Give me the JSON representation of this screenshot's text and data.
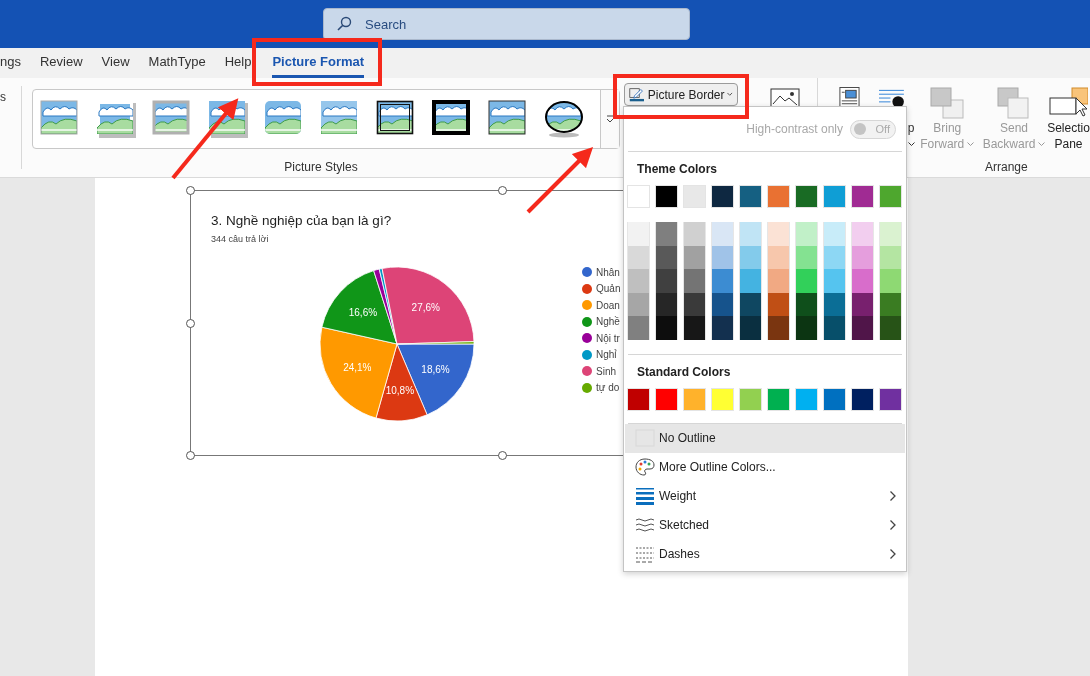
{
  "title_bar": {
    "search": {
      "placeholder": "Search"
    }
  },
  "tabs": [
    {
      "label": "ngs",
      "selected": false
    },
    {
      "label": "Review",
      "selected": false
    },
    {
      "label": "View",
      "selected": false
    },
    {
      "label": "MathType",
      "selected": false
    },
    {
      "label": "Help",
      "selected": false
    },
    {
      "label": "Picture Format",
      "selected": true
    }
  ],
  "ribbon": {
    "left_fragment": "s",
    "picture_styles": {
      "label": "Picture Styles"
    },
    "picture_border": {
      "label": "Picture Border",
      "dropdown": true
    },
    "wrap_fragment": {
      "label": "p",
      "dropdown": true
    },
    "arrange": {
      "label": "Arrange",
      "buttons": [
        {
          "kind": "bring-forward",
          "lines": [
            "Bring",
            "Forward"
          ],
          "disabled": true,
          "dropdown": true
        },
        {
          "kind": "send-backward",
          "lines": [
            "Send",
            "Backward"
          ],
          "disabled": true,
          "dropdown": true
        },
        {
          "kind": "selection-pane",
          "lines": [
            "Selectio",
            "Pane"
          ],
          "disabled": false,
          "dropdown": false
        }
      ]
    }
  },
  "document": {
    "picture": {
      "subtitle": "344 câu trả lời",
      "chart_data": {
        "type": "pie",
        "title": "3. Nghề nghiệp của bạn là gì?",
        "categories": [
          "Nhân",
          "Quản",
          "Doan",
          "Nghề",
          "Nội tr",
          "Nghỉ",
          "Sinh",
          "tự do"
        ],
        "values": [
          18.6,
          10.8,
          24.1,
          16.6,
          1.2,
          0.6,
          27.6,
          0.5
        ],
        "value_labels": [
          "18,6%",
          "10,8%",
          "24,1%",
          "16,6%",
          null,
          null,
          "27,6%",
          null
        ],
        "colors": [
          "#3366cc",
          "#dc3912",
          "#ff9900",
          "#109618",
          "#990099",
          "#0099c6",
          "#dd4477",
          "#66aa00"
        ]
      }
    }
  },
  "border_menu": {
    "high_contrast": {
      "label": "High-contrast only",
      "on": false,
      "disabled": true,
      "state_label": "Off"
    },
    "theme_colors": {
      "label": "Theme Colors",
      "columns": [
        {
          "color": "#ffffff",
          "shades": [
            {
              "color": "#f2f2f2"
            },
            {
              "color": "#d9d9d9"
            },
            {
              "color": "#bfbfbf"
            },
            {
              "color": "#a6a6a6"
            },
            {
              "color": "#808080"
            }
          ]
        },
        {
          "color": "#000000",
          "shades": [
            {
              "color": "#7f7f7f"
            },
            {
              "color": "#595959"
            },
            {
              "color": "#404040"
            },
            {
              "color": "#262626"
            },
            {
              "color": "#0d0d0d"
            }
          ]
        },
        {
          "color": "#e8e8e8",
          "shades": [
            {
              "color": "#d0d0d0"
            },
            {
              "color": "#a1a1a1"
            },
            {
              "color": "#747474"
            },
            {
              "color": "#3a3a3a"
            },
            {
              "color": "#171717"
            }
          ]
        },
        {
          "color": "#0e2841",
          "shades": [
            {
              "color": "#d9e6f5"
            },
            {
              "color": "#a0c3e8"
            },
            {
              "color": "#3c8cd2"
            },
            {
              "color": "#16538c"
            },
            {
              "color": "#13304f"
            }
          ]
        },
        {
          "color": "#156082",
          "shades": [
            {
              "color": "#c0e4f5"
            },
            {
              "color": "#83cbeb"
            },
            {
              "color": "#44b3e1"
            },
            {
              "color": "#0f4761"
            },
            {
              "color": "#0a2f40"
            }
          ]
        },
        {
          "color": "#e97132",
          "shades": [
            {
              "color": "#fbe2d5"
            },
            {
              "color": "#f7c7ac"
            },
            {
              "color": "#f1a983"
            },
            {
              "color": "#c04f15"
            },
            {
              "color": "#7a3510"
            }
          ]
        },
        {
          "color": "#196b24",
          "shades": [
            {
              "color": "#c1f0c8"
            },
            {
              "color": "#84e291"
            },
            {
              "color": "#32d05a"
            },
            {
              "color": "#0f4f1b"
            },
            {
              "color": "#0c3512"
            }
          ]
        },
        {
          "color": "#0f9ed5",
          "shades": [
            {
              "color": "#c8ecf9"
            },
            {
              "color": "#8dd7f4"
            },
            {
              "color": "#55c4ef"
            },
            {
              "color": "#0b6e96"
            },
            {
              "color": "#074f6a"
            }
          ]
        },
        {
          "color": "#a02b93",
          "shades": [
            {
              "color": "#f2ceef"
            },
            {
              "color": "#e59edd"
            },
            {
              "color": "#d86dcb"
            },
            {
              "color": "#78206e"
            },
            {
              "color": "#501549"
            }
          ]
        },
        {
          "color": "#4ea72e",
          "shades": [
            {
              "color": "#daf2d0"
            },
            {
              "color": "#b4e5a2"
            },
            {
              "color": "#8ed973"
            },
            {
              "color": "#3a7c22"
            },
            {
              "color": "#275317"
            }
          ]
        }
      ]
    },
    "standard_colors": {
      "label": "Standard Colors",
      "swatches": [
        {
          "color": "#c00000"
        },
        {
          "color": "#ff0000"
        },
        {
          "color": "#ffb22b"
        },
        {
          "color": "#ffff33"
        },
        {
          "color": "#92d050"
        },
        {
          "color": "#00b050"
        },
        {
          "color": "#00b0f0"
        },
        {
          "color": "#0070c0"
        },
        {
          "color": "#002060"
        },
        {
          "color": "#7030a0"
        }
      ]
    },
    "items": [
      {
        "kind": "no-outline",
        "label": "No Outline",
        "highlighted": true,
        "submenu": false
      },
      {
        "kind": "more-colors",
        "label": "More Outline Colors...",
        "highlighted": false,
        "submenu": false
      },
      {
        "kind": "weight",
        "label": "Weight",
        "highlighted": false,
        "submenu": true
      },
      {
        "kind": "sketched",
        "label": "Sketched",
        "highlighted": false,
        "submenu": true
      },
      {
        "kind": "dashes",
        "label": "Dashes",
        "highlighted": false,
        "submenu": true
      }
    ]
  }
}
